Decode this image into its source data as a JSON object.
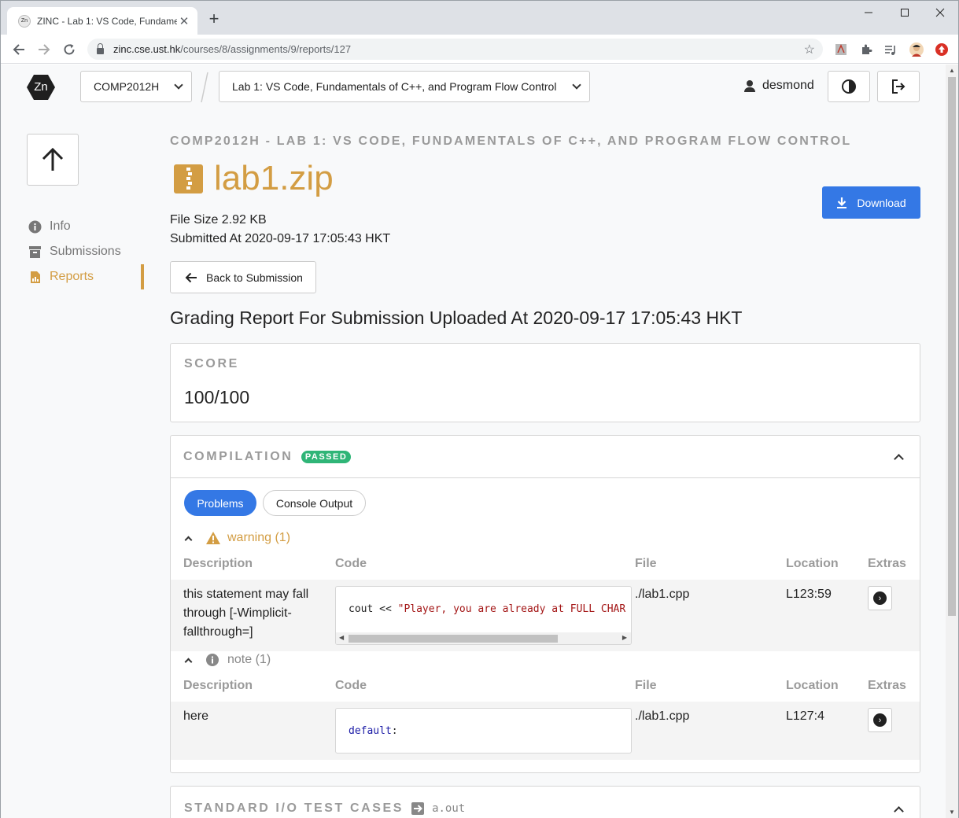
{
  "browser": {
    "tab_title": "ZINC - Lab 1: VS Code, Fundamentals of C++, and Program Flow Control",
    "tab_favicon_text": "Zn",
    "url_host": "zinc.cse.ust.hk",
    "url_path": "/courses/8/assignments/9/reports/127"
  },
  "header": {
    "logo_text": "Zn",
    "course_select": "COMP2012H",
    "assignment_select": "Lab 1: VS Code, Fundamentals of C++, and Program Flow Control",
    "username": "desmond"
  },
  "sidebar": {
    "items": [
      {
        "label": "Info",
        "icon": "info-icon"
      },
      {
        "label": "Submissions",
        "icon": "archive-icon"
      },
      {
        "label": "Reports",
        "icon": "report-icon",
        "active": true
      }
    ]
  },
  "main": {
    "breadcrumb": "COMP2012H - LAB 1: VS CODE, FUNDAMENTALS OF C++, AND PROGRAM FLOW CONTROL",
    "filename": "lab1.zip",
    "download_label": "Download",
    "file_size_label": "File Size 2.92 KB",
    "submitted_at_label": "Submitted At 2020-09-17 17:05:43 HKT",
    "back_label": "Back to Submission",
    "report_heading": "Grading Report For Submission Uploaded At 2020-09-17 17:05:43 HKT"
  },
  "score": {
    "title": "SCORE",
    "value": "100/100"
  },
  "compilation": {
    "title": "COMPILATION",
    "status": "PASSED",
    "tabs": {
      "problems": "Problems",
      "console": "Console Output"
    },
    "columns": {
      "description": "Description",
      "code": "Code",
      "file": "File",
      "location": "Location",
      "extras": "Extras"
    },
    "groups": [
      {
        "label": "warning (1)",
        "row": {
          "description": "this statement may fall through [-Wimplicit-fallthrough=]",
          "code_plain": "cout << ",
          "code_string": "\"Player, you are already at FULL CHAR",
          "file": "./lab1.cpp",
          "location": "L123:59"
        }
      },
      {
        "label": "note (1)",
        "row": {
          "description": "here",
          "code_keyword": "default",
          "code_plain": ":",
          "file": "./lab1.cpp",
          "location": "L127:4"
        }
      }
    ]
  },
  "stdio": {
    "title": "STANDARD I/O TEST CASES",
    "executable": "a.out"
  },
  "colors": {
    "accent_gold": "#d39d43",
    "primary_blue": "#3478e5",
    "passed_green": "#2fb577"
  }
}
